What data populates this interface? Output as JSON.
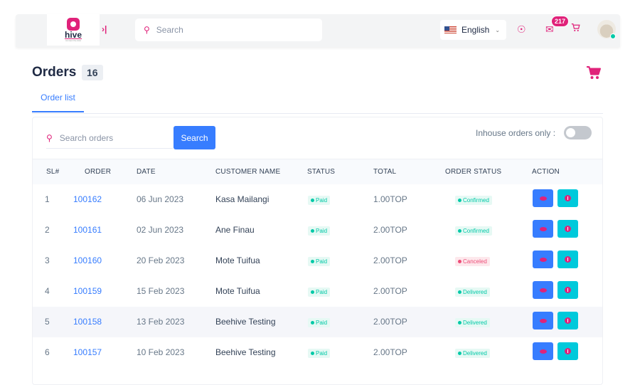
{
  "topbar": {
    "logo_text": "hive",
    "logo_tagline": "connect the dots",
    "search_placeholder": "Search",
    "language": "English",
    "message_count": "217"
  },
  "page": {
    "title": "Orders",
    "count": "16",
    "tab": "Order list"
  },
  "filters": {
    "search_placeholder": "Search orders",
    "search_button": "Search",
    "inhouse_label": "Inhouse orders only :"
  },
  "table": {
    "headers": [
      "SL#",
      "ORDER",
      "DATE",
      "CUSTOMER NAME",
      "STATUS",
      "TOTAL",
      "ORDER STATUS",
      "ACTION"
    ],
    "rows": [
      {
        "sl": "1",
        "order": "100162",
        "date": "06 Jun 2023",
        "customer": "Kasa Mailangi",
        "status": "Paid",
        "total": "1.00TOP",
        "order_status": "Confirmed"
      },
      {
        "sl": "2",
        "order": "100161",
        "date": "02 Jun 2023",
        "customer": "Ane Finau",
        "status": "Paid",
        "total": "2.00TOP",
        "order_status": "Confirmed"
      },
      {
        "sl": "3",
        "order": "100160",
        "date": "20 Feb 2023",
        "customer": "Mote Tuifua",
        "status": "Paid",
        "total": "2.00TOP",
        "order_status": "Canceled"
      },
      {
        "sl": "4",
        "order": "100159",
        "date": "15 Feb 2023",
        "customer": "Mote Tuifua",
        "status": "Paid",
        "total": "2.00TOP",
        "order_status": "Delivered"
      },
      {
        "sl": "5",
        "order": "100158",
        "date": "13 Feb 2023",
        "customer": "Beehive Testing",
        "status": "Paid",
        "total": "2.00TOP",
        "order_status": "Delivered"
      },
      {
        "sl": "6",
        "order": "100157",
        "date": "10 Feb 2023",
        "customer": "Beehive Testing",
        "status": "Paid",
        "total": "2.00TOP",
        "order_status": "Delivered"
      }
    ]
  },
  "colors": {
    "accent": "#e0227a",
    "primary": "#377dff",
    "success": "#00c9a7",
    "danger": "#ed4c78",
    "info": "#00c9db"
  }
}
